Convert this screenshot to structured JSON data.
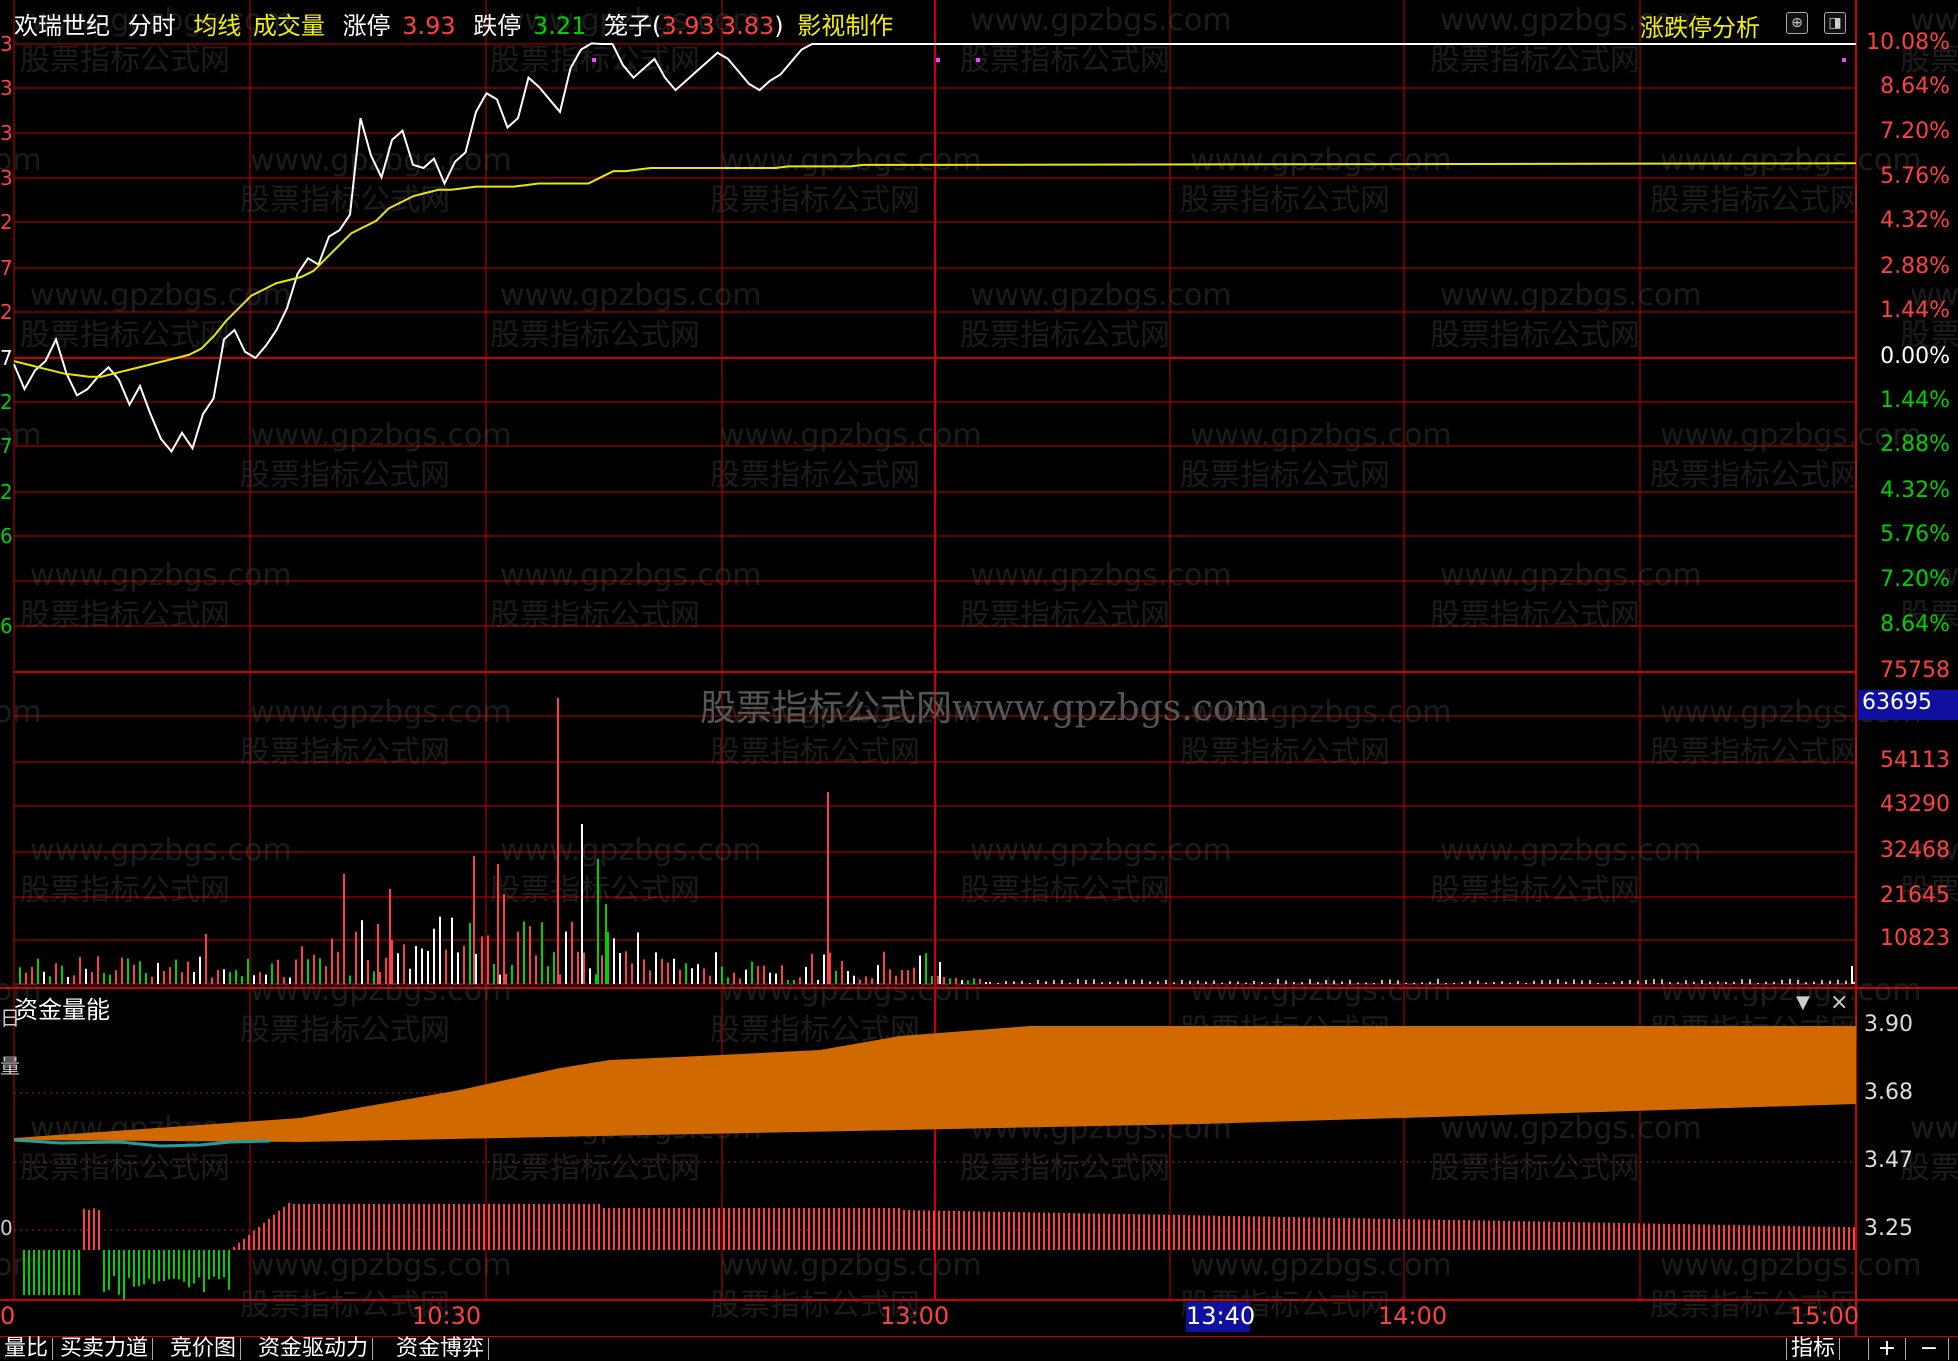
{
  "header": {
    "stock_name": "欢瑞世纪",
    "mode": "分时",
    "avg_line": "均线",
    "volume_label": "成交量",
    "limit_up_label": "涨停",
    "limit_up_value": "3.93",
    "limit_down_label": "跌停",
    "limit_down_value": "3.21",
    "cage_label": "笼子(",
    "cage_high": "3.93",
    "cage_low": "3.83",
    "cage_close": ")",
    "author": "影视制作",
    "analysis": "涨跌停分析"
  },
  "colors": {
    "grid": "#cc0000",
    "up": "#ff4040",
    "down": "#00d000",
    "price": "#ffffff",
    "avg": "#e8e800",
    "orange": "#d06a00",
    "teal": "#20a0a0"
  },
  "price_axis": {
    "right_labels": [
      "10.08%",
      "8.64%",
      "7.20%",
      "5.76%",
      "4.32%",
      "2.88%",
      "1.44%",
      "0.00%",
      "1.44%",
      "2.88%",
      "4.32%",
      "5.76%",
      "7.20%",
      "8.64%"
    ],
    "left_fragments": [
      "3",
      "3",
      "3",
      "3",
      "2",
      "7",
      "2",
      "7",
      "2",
      "7",
      "2",
      "6",
      "",
      "6"
    ]
  },
  "volume_axis": {
    "labels": [
      "75758",
      "54113",
      "43290",
      "32468",
      "21645",
      "10823"
    ],
    "highlight": "63695"
  },
  "indicator": {
    "title": "资金量能",
    "labels": [
      "3.90",
      "3.68",
      "3.47",
      "3.25"
    ],
    "left_fragments": [
      "日",
      "量",
      "",
      "0"
    ]
  },
  "time_axis": {
    "labels": [
      "0",
      "10:30",
      "13:00",
      "14:00",
      "15:00"
    ],
    "highlight": "13:40"
  },
  "watermarks": {
    "url": "www.gpzbgs.com",
    "name": "股票指标公式网",
    "center": "股票指标公式网www.gpzbgs.com"
  },
  "tabs": [
    "量比",
    "买卖力道",
    "竞价图",
    "资金驱动力",
    "资金博弈"
  ],
  "bottom_right": [
    "指标",
    "+",
    "−"
  ],
  "chart_data": {
    "type": "line",
    "price_series": [
      -0.2,
      -1.0,
      -0.4,
      -0.1,
      0.6,
      -0.5,
      -1.2,
      -1.0,
      -0.6,
      -0.3,
      -0.7,
      -1.5,
      -0.9,
      -1.8,
      -2.6,
      -3.0,
      -2.4,
      -2.9,
      -1.8,
      -1.3,
      0.6,
      0.9,
      0.2,
      0.0,
      0.4,
      0.9,
      1.6,
      2.7,
      3.2,
      3.0,
      3.9,
      4.1,
      4.6,
      7.7,
      6.5,
      5.8,
      7.0,
      7.3,
      6.2,
      6.1,
      6.4,
      5.6,
      6.3,
      6.6,
      7.9,
      8.5,
      8.3,
      7.4,
      7.7,
      9.0,
      8.7,
      8.3,
      7.9,
      9.3,
      9.9,
      10.1,
      10.08,
      10.08,
      9.4,
      9.0,
      9.3,
      9.6,
      9.0,
      8.6,
      8.9,
      9.2,
      9.5,
      9.8,
      9.6,
      9.2,
      8.8,
      8.6,
      8.9,
      9.1,
      9.5,
      9.9,
      10.08,
      10.08,
      10.08,
      10.08,
      10.08,
      10.08,
      10.08,
      10.08,
      10.08,
      10.08,
      10.08,
      10.08,
      10.08
    ],
    "avg_series": [
      -0.1,
      -0.2,
      -0.3,
      -0.4,
      -0.5,
      -0.55,
      -0.6,
      -0.6,
      -0.5,
      -0.4,
      -0.3,
      -0.2,
      -0.1,
      0.0,
      0.1,
      0.3,
      0.7,
      1.2,
      1.6,
      2.0,
      2.2,
      2.4,
      2.5,
      2.6,
      2.8,
      3.2,
      3.6,
      4.0,
      4.2,
      4.4,
      4.8,
      5.0,
      5.2,
      5.3,
      5.4,
      5.4,
      5.45,
      5.5,
      5.5,
      5.5,
      5.5,
      5.55,
      5.6,
      5.6,
      5.6,
      5.6,
      5.6,
      5.8,
      6.0,
      6.0,
      6.05,
      6.1,
      6.1,
      6.1,
      6.1,
      6.1,
      6.1,
      6.1,
      6.1,
      6.1,
      6.1,
      6.1,
      6.15,
      6.15,
      6.15,
      6.15,
      6.15,
      6.15,
      6.2,
      6.2,
      6.2,
      6.2,
      6.2,
      6.2,
      6.2
    ],
    "ylim": [
      -10.08,
      10.08
    ],
    "volume_peak": 63695
  }
}
